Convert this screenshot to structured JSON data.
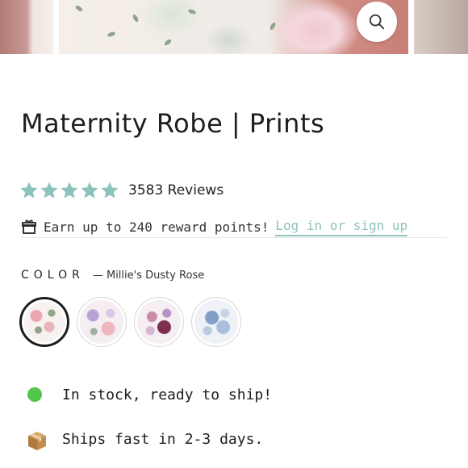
{
  "product": {
    "title": "Maternity Robe | Prints"
  },
  "gallery": {
    "zoom_icon": "search-icon"
  },
  "rating": {
    "stars": 5,
    "star_color": "#8ec3bd",
    "reviews_label": "3583 Reviews"
  },
  "rewards": {
    "icon": "gift-icon",
    "text": "Earn up to 240 reward points!",
    "link_label": "Log in or sign up",
    "link_color": "#8ec3bd"
  },
  "color": {
    "label": "COLOR",
    "selected_value": "— Millie's Dusty Rose",
    "swatches": [
      "Millie's Dusty Rose",
      "Lavender Floral",
      "Plum Floral",
      "Blue Watercolor"
    ]
  },
  "availability": {
    "stock_text": "In stock, ready to ship!",
    "stock_color": "#52c64a",
    "shipping_icon": "package-icon",
    "shipping_text": "Ships fast in 2-3 days."
  }
}
